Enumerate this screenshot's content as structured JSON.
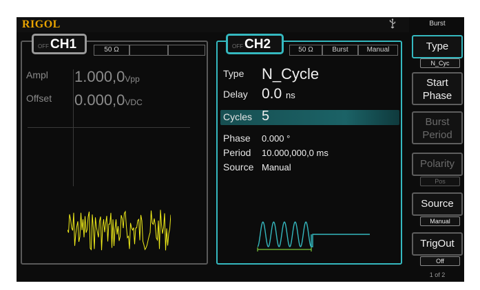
{
  "brand": "RIGOL",
  "ch1": {
    "off_label": "OFF",
    "name": "CH1",
    "impedance": "50 Ω",
    "ampl_label": "Ampl",
    "ampl_value": "1.000,0",
    "ampl_unit": "Vpp",
    "offset_label": "Offset",
    "offset_value": "0.000,0",
    "offset_unit": "VDC"
  },
  "ch2": {
    "off_label": "OFF",
    "name": "CH2",
    "impedance": "50 Ω",
    "mode": "Burst",
    "trigger": "Manual",
    "type_label": "Type",
    "type_value": "N_Cycle",
    "delay_label": "Delay",
    "delay_value": "0.0",
    "delay_unit": "ns",
    "cycles_label": "Cycles",
    "cycles_value": "5",
    "phase_label": "Phase",
    "phase_value": "0.000 °",
    "period_label": "Period",
    "period_value": "10.000,000,0 ms",
    "source_label": "Source",
    "source_value": "Manual"
  },
  "menu": {
    "title": "Burst",
    "type_label": "Type",
    "type_value": "N_Cyc",
    "start_phase_line1": "Start",
    "start_phase_line2": "Phase",
    "burst_period_line1": "Burst",
    "burst_period_line2": "Period",
    "polarity_label": "Polarity",
    "polarity_value": "Pos",
    "source_label": "Source",
    "source_value": "Manual",
    "trigout_label": "TrigOut",
    "trigout_value": "Off",
    "page": "1 of 2"
  },
  "colors": {
    "brand": "#e8a300",
    "ch1_wave": "#f2ee1a",
    "ch2_accent": "#35b9c0",
    "burst_marker": "#7cc63a"
  },
  "icons": {
    "usb": "usb-icon"
  }
}
